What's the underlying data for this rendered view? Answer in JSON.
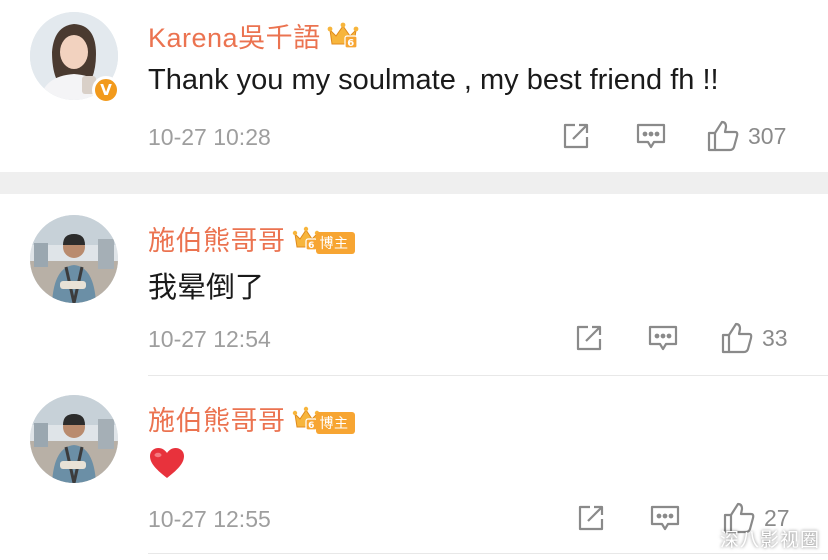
{
  "comments": [
    {
      "username": "Karena吳千語",
      "badge": "crown-vip",
      "content": "Thank you my soulmate , my best friend fh !!",
      "time": "10-27 10:28",
      "likes": "307"
    },
    {
      "username": "施伯熊哥哥",
      "badge": "crown-blogger",
      "badge_label": "博主",
      "content": "我晕倒了",
      "time": "10-27 12:54",
      "likes": "33"
    },
    {
      "username": "施伯熊哥哥",
      "badge": "crown-blogger",
      "badge_label": "博主",
      "content": "heart-emoji",
      "time": "10-27 12:55",
      "likes": "27"
    }
  ],
  "watermark": "深八影视圈",
  "colors": {
    "username": "#eb7350",
    "badge": "#f7a532",
    "verified": "#f29a1c",
    "heart": "#e8323c"
  }
}
